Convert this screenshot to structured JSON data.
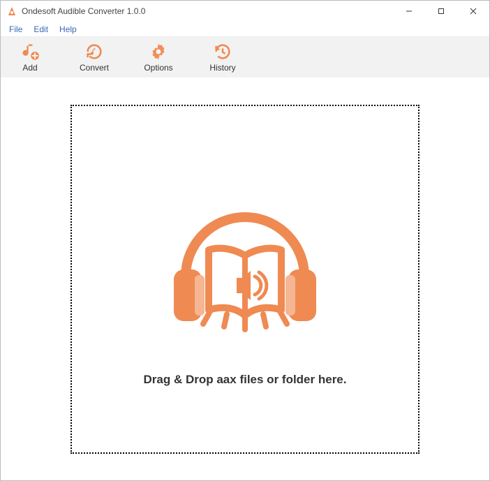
{
  "window": {
    "title": "Ondesoft Audible Converter 1.0.0"
  },
  "menu": {
    "file": "File",
    "edit": "Edit",
    "help": "Help"
  },
  "toolbar": {
    "add": "Add",
    "convert": "Convert",
    "options": "Options",
    "history": "History"
  },
  "dropzone": {
    "prompt": "Drag & Drop aax files or folder here."
  },
  "colors": {
    "accent": "#ef8a52",
    "menu_text": "#3a67b4"
  }
}
